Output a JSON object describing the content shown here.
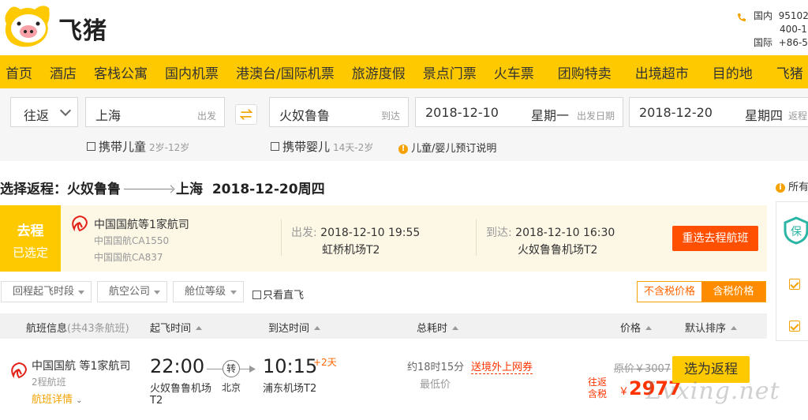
{
  "brand": {
    "name": "飞猪",
    "accent": "#ffc900",
    "logo_icon": "pig-logo-icon"
  },
  "contact": {
    "domestic_label": "国内",
    "domestic_1": "95102",
    "domestic_2": "400-1",
    "intl_label": "国际",
    "intl": "+86-5"
  },
  "nav": {
    "items": [
      "首页",
      "酒店",
      "客栈公寓",
      "国内机票",
      "港澳台/国际机票",
      "旅游度假",
      "景点门票",
      "火车票",
      "团购特卖",
      "出境超市",
      "目的地",
      "飞猪"
    ]
  },
  "search": {
    "trip_type": "往返",
    "from_city": "上海",
    "from_hint": "出发",
    "to_city": "火奴鲁鲁",
    "to_hint": "到达",
    "depart_date": "2018-12-10",
    "depart_weekday": "星期一",
    "depart_hint": "出发日期",
    "return_date": "2018-12-20",
    "return_weekday": "星期四",
    "return_hint": "返程",
    "child_label": "携带儿童",
    "child_age": "2岁-12岁",
    "infant_label": "携带婴儿",
    "infant_age": "14天-2岁",
    "booking_note": "儿童/婴儿预订说明"
  },
  "heading": {
    "prefix": "选择返程：",
    "from": "火奴鲁鲁",
    "to": "上海",
    "date": "2018-12-20周四"
  },
  "outbound": {
    "tag_1": "去程",
    "tag_2": "已选定",
    "airline": "中国国航等1家航司",
    "flight_1": "中国国航CA1550",
    "flight_2": "中国国航CA837",
    "depart_label": "出发:",
    "depart_time": "2018-12-10 19:55",
    "depart_airport": "虹桥机场T2",
    "arrive_label": "到达:",
    "arrive_time": "2018-12-10 16:30",
    "arrive_airport": "火奴鲁鲁机场T2",
    "rechoose": "重选去程航班"
  },
  "filters": {
    "depart_time": "回程起飞时段",
    "airline": "航空公司",
    "cabin": "舱位等级",
    "direct": "只看直飞",
    "tax_excluded": "不含税价格",
    "tax_included": "含税价格"
  },
  "table_header": {
    "flight_info": "航班信息",
    "flight_count": "(共43条航班)",
    "depart_time": "起飞时间",
    "arrive_time": "到达时间",
    "duration": "总耗时",
    "price": "价格",
    "sort": "默认排序"
  },
  "flights": [
    {
      "airline": "中国国航 等1家航司",
      "legs": "2程航班",
      "details": "航班详情",
      "depart_time": "22:00",
      "depart_airport": "火奴鲁鲁机场",
      "depart_terminal": "T2",
      "transfer_badge": "转",
      "transfer_city": "北京",
      "arrive_time": "10:15",
      "plus_days": "+2天",
      "arrive_airport": "浦东机场T2",
      "duration": "约18时15分",
      "lowest": "最低价",
      "coupon": "送境外上网券",
      "original_price": "原价￥3007",
      "roundtrip_label_1": "往返",
      "roundtrip_label_2": "含税",
      "currency": "￥",
      "price": "2977",
      "select": "选为返程"
    }
  ],
  "sidebar": {
    "all_label": "所有"
  },
  "watermark": "Lvxing.net"
}
